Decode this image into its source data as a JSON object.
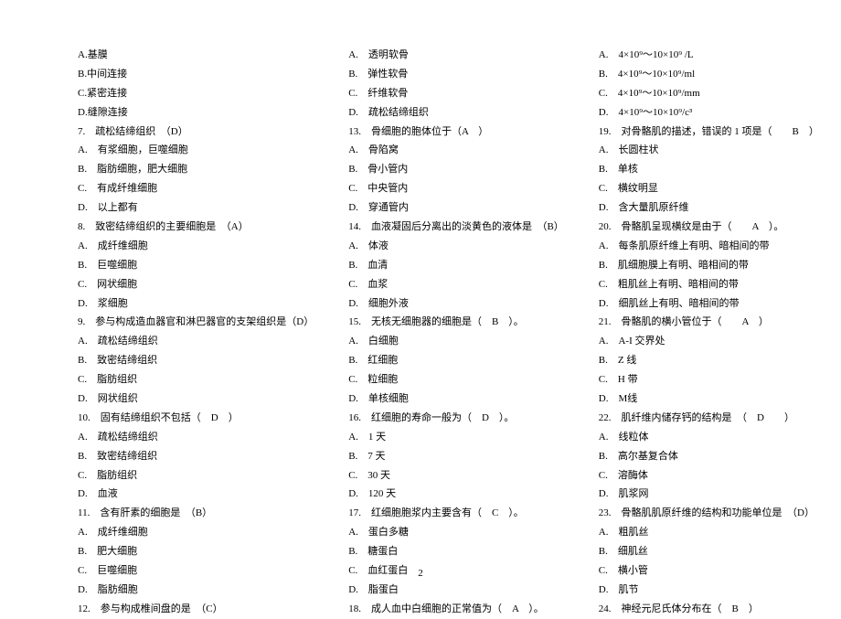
{
  "page_number": "2",
  "columns": [
    [
      "A.基膜",
      "B.中间连接",
      "C.紧密连接",
      "D.缝隙连接",
      "7.　疏松结缔组织　（D）",
      "A.　有浆细胞，巨噬细胞",
      "B.　脂肪细胞，肥大细胞",
      "C.　有成纤维细胞",
      "D.　以上都有",
      "8.　致密结缔组织的主要细胞是　（A）",
      "A.　成纤维细胞",
      "B.　巨噬细胞",
      "C.　网状细胞",
      "D.　浆细胞",
      "9.　参与构成造血器官和淋巴器官的支架组织是（D）",
      "A.　疏松结缔组织",
      "B.　致密结缔组织",
      "C.　脂肪组织",
      "D.　网状组织",
      "10.　固有结缔组织不包括（　D　）",
      "A.　疏松结缔组织",
      "B.　致密结缔组织",
      "C.　脂肪组织",
      "D.　血液",
      "11.　含有肝素的细胞是　（B）",
      "A.　成纤维细胞",
      "B.　肥大细胞",
      "C.　巨噬细胞",
      "D.　脂肪细胞",
      "12.　参与构成椎间盘的是　（C）"
    ],
    [
      "A.　透明软骨",
      "B.　弹性软骨",
      "C.　纤维软骨",
      "D.　疏松结缔组织",
      "13.　骨细胞的胞体位于（A　）",
      "A.　骨陷窝",
      "B.　骨小管内",
      "C.　中央管内",
      "D.　穿通管内",
      "14.　血液凝固后分离出的淡黄色的液体是　（B）",
      "A.　体液",
      "B.　血清",
      "C.　血浆",
      "D.　细胞外液",
      "15.　无核无细胞器的细胞是（　B　）。",
      "A.　白细胞",
      "B.　红细胞",
      "C.　粒细胞",
      "D.　单核细胞",
      "16.　红细胞的寿命一般为（　D　）。",
      "A.　1 天",
      "B.　7 天",
      "C.　30 天",
      "D.　120 天",
      "17.　红细胞胞浆内主要含有（　C　）。",
      "A.　蛋白多糖",
      "B.　糖蛋白",
      "C.　血红蛋白",
      "D.　脂蛋白",
      "18.　成人血中白细胞的正常值为（　A　）。"
    ],
    [
      "A.　4×10⁹～10×10⁹ /L",
      "B.　4×10⁹～10×10⁹/ml",
      "C.　4×10⁹～10×10⁹/mm",
      "D.　4×10⁹～10×10⁹/c³",
      "19.　对骨骼肌的描述，错误的 1 项是（　　B　）",
      "A.　长圆柱状",
      "B.　单核",
      "C.　横纹明显",
      "D.　含大量肌原纤维",
      "20.　骨骼肌呈现横纹是由于（　　A　）。",
      "A.　每条肌原纤维上有明、暗相间的带",
      "B.　肌细胞膜上有明、暗相间的带",
      "C.　粗肌丝上有明、暗相间的带",
      "D.　细肌丝上有明、暗相间的带",
      "21.　骨骼肌的横小管位于（　　A　）",
      "A.　A-I 交界处",
      "B.　Z 线",
      "C.　H 带",
      "D.　M线",
      "22.　肌纤维内储存钙的结构是　（　D　　）",
      "A.　线粒体",
      "B.　高尔基复合体",
      "C.　溶酶体",
      "D.　肌浆网",
      "23.　骨骼肌肌原纤维的结构和功能单位是　（D）",
      "A.　粗肌丝",
      "B.　细肌丝",
      "C.　横小管",
      "D.　肌节",
      "24.　神经元尼氏体分布在（　B　）"
    ]
  ]
}
